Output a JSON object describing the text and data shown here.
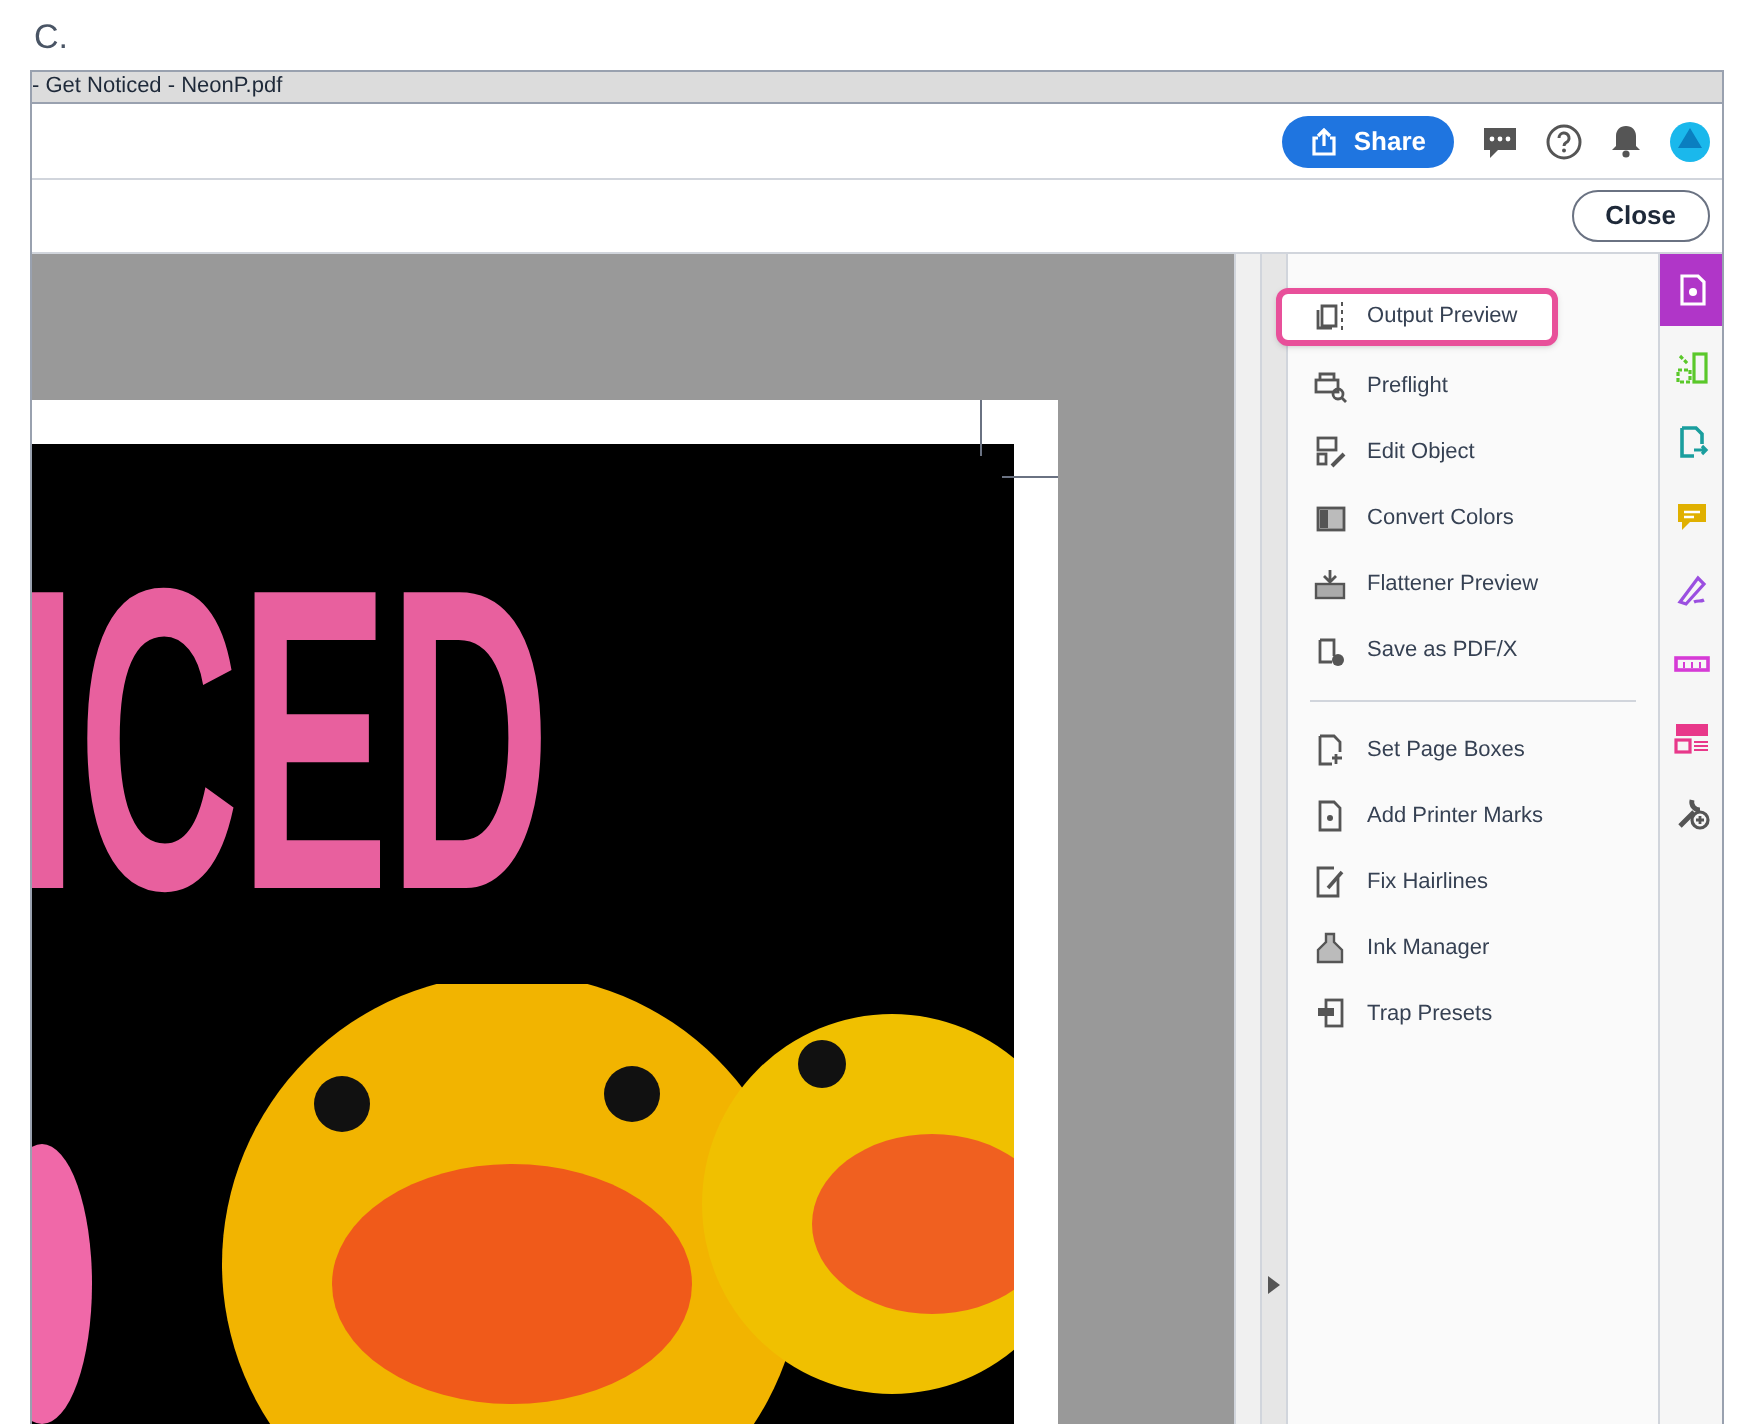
{
  "figure_label": "C.",
  "window": {
    "title": "- Get Noticed - NeonP.pdf"
  },
  "toolbar": {
    "share_button": "Share"
  },
  "secondary_bar": {
    "close_button": "Close"
  },
  "document": {
    "headline": "ICED"
  },
  "tools_panel": {
    "groups": [
      [
        {
          "label": "Output Preview",
          "selected": true
        },
        {
          "label": "Preflight",
          "selected": false
        },
        {
          "label": "Edit Object",
          "selected": false
        },
        {
          "label": "Convert Colors",
          "selected": false
        },
        {
          "label": "Flattener Preview",
          "selected": false
        },
        {
          "label": "Save as PDF/X",
          "selected": false
        }
      ],
      [
        {
          "label": "Set Page Boxes",
          "selected": false
        },
        {
          "label": "Add Printer Marks",
          "selected": false
        },
        {
          "label": "Fix Hairlines",
          "selected": false
        },
        {
          "label": "Ink Manager",
          "selected": false
        },
        {
          "label": "Trap Presets",
          "selected": false
        }
      ]
    ]
  },
  "tool_rail": [
    {
      "selected": true,
      "color": "#ffffff"
    },
    {
      "selected": false,
      "color": "#5ac82a"
    },
    {
      "selected": false,
      "color": "#1a9e9e"
    },
    {
      "selected": false,
      "color": "#e0b000"
    },
    {
      "selected": false,
      "color": "#9b4fe0"
    },
    {
      "selected": false,
      "color": "#d63bd6"
    },
    {
      "selected": false,
      "color": "#e8388a"
    },
    {
      "selected": false,
      "color": "#555555"
    }
  ]
}
